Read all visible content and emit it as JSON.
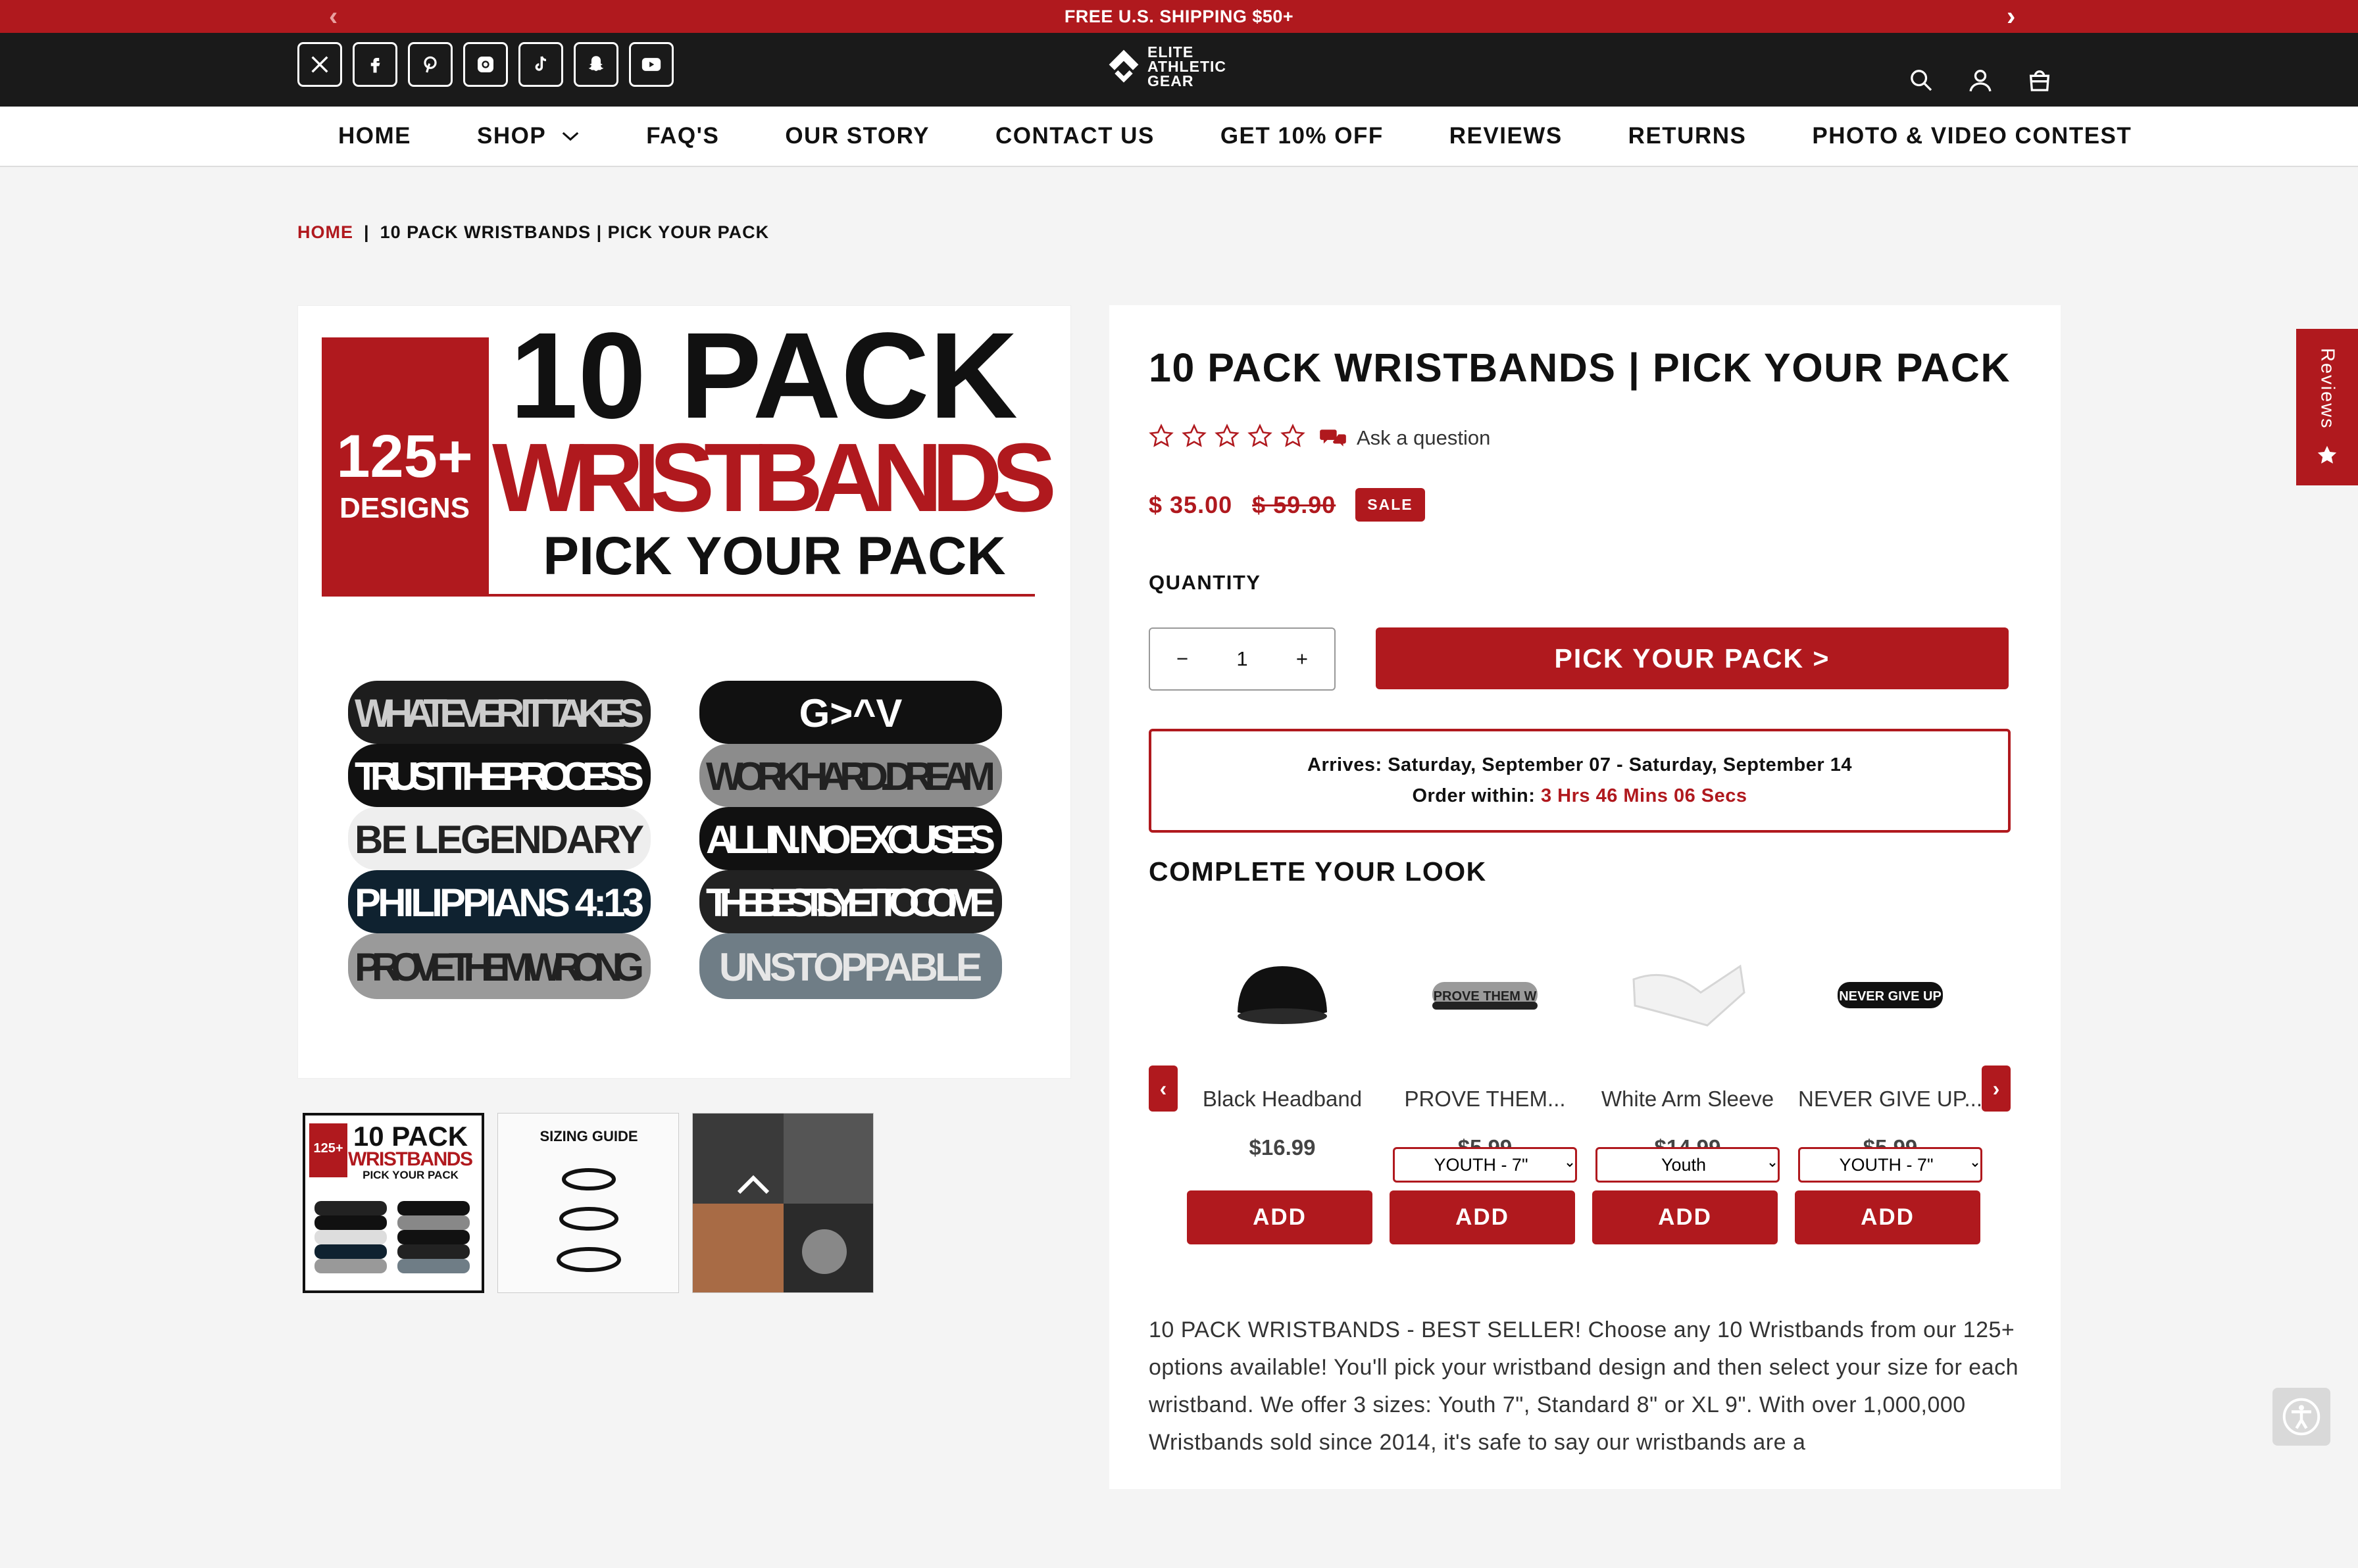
{
  "announcement": {
    "text": "FREE U.S. SHIPPING $50+"
  },
  "header": {
    "socials": [
      "x-icon",
      "facebook-icon",
      "pinterest-icon",
      "instagram-icon",
      "tiktok-icon",
      "snapchat-icon",
      "youtube-icon"
    ],
    "logo_lines": [
      "ELITE",
      "ATHLETIC",
      "GEAR"
    ]
  },
  "nav": {
    "items": [
      "HOME",
      "SHOP",
      "FAQ'S",
      "OUR STORY",
      "CONTACT US",
      "GET 10% OFF",
      "REVIEWS",
      "RETURNS",
      "PHOTO & VIDEO CONTEST"
    ]
  },
  "breadcrumb": {
    "home": "HOME",
    "separator": "|",
    "current": "10 PACK WRISTBANDS | PICK YOUR PACK"
  },
  "hero": {
    "count": "125+",
    "designs": "DESIGNS",
    "line1": "10 PACK",
    "line2": "WRISTBANDS",
    "line3": "PICK YOUR PACK",
    "bands_left": [
      "WHATEVER IT TAKES",
      "TRUST THE PROCESS",
      "BE LEGENDARY",
      "PHILIPPIANS 4:13",
      "PROVE THEM WRONG"
    ],
    "bands_right": [
      "G>^V",
      "WORK HARD. DREAM",
      "ALL IN. NO EXCUSES",
      "THE BEST IS YET TO COME",
      "UNSTOPPABLE"
    ]
  },
  "thumbs": {
    "sizing_title": "SIZING GUIDE"
  },
  "product": {
    "title": "10 PACK WRISTBANDS | PICK YOUR PACK",
    "ask": "Ask a question",
    "price": "$ 35.00",
    "compare_price": "$ 59.90",
    "sale_badge": "SALE",
    "quantity_label": "QUANTITY",
    "quantity_value": "1",
    "pick_button": "PICK YOUR PACK >",
    "arrives_label": "Arrives:",
    "arrives_value": "Saturday, September 07 - Saturday, September 14",
    "order_label": "Order within:",
    "order_value": "3 Hrs 46 Mins 06 Secs"
  },
  "complete_look": {
    "title": "COMPLETE YOUR LOOK",
    "items": [
      {
        "name": "Black Headband",
        "price": "$16.99",
        "add": "ADD"
      },
      {
        "name": "PROVE THEM...",
        "price": "$5.99",
        "option": "YOUTH - 7\"",
        "add": "ADD"
      },
      {
        "name": "White Arm Sleeve",
        "price": "$14.99",
        "option": "Youth",
        "add": "ADD"
      },
      {
        "name": "NEVER GIVE UP...",
        "price": "$5.99",
        "option": "YOUTH - 7\"",
        "add": "ADD"
      }
    ]
  },
  "description": "10 PACK WRISTBANDS - BEST SELLER! Choose any 10 Wristbands from our 125+ options available! You'll pick your wristband design and then select your size for each wristband. We offer 3 sizes: Youth 7\", Standard 8\" or XL 9\". With over 1,000,000 Wristbands sold since 2014, it's safe to say our wristbands are a",
  "reviews_tab": "Reviews",
  "colors": {
    "brand_red": "#b0191e",
    "header_dark": "#1a1a1a"
  }
}
